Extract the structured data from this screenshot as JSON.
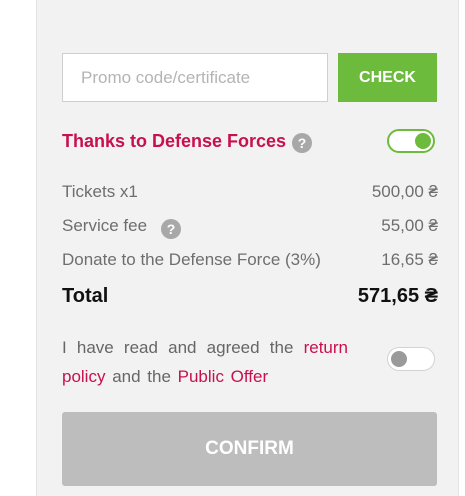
{
  "promo": {
    "placeholder": "Promo code/certificate",
    "value": "",
    "check_label": "CHECK"
  },
  "defense": {
    "label": "Thanks to Defense Forces",
    "help_icon": "question-circle-icon",
    "help_glyph": "?",
    "enabled": true
  },
  "summary": {
    "lines": [
      {
        "label": "Tickets x1",
        "value": "500,00 ₴",
        "has_help": false
      },
      {
        "label": "Service fee",
        "value": "55,00 ₴",
        "has_help": true,
        "help_glyph": "?"
      },
      {
        "label": "Donate to the Defense Force (3%)",
        "value": "16,65 ₴",
        "has_help": false
      }
    ],
    "total_label": "Total",
    "total_value": "571,65 ₴"
  },
  "agreement": {
    "text_before": "I have read and agreed the ",
    "return_policy_link": "return policy",
    "text_middle": " and the ",
    "public_offer_link": "Public Offer",
    "checked": false
  },
  "confirm": {
    "label": "CONFIRM",
    "enabled": false
  },
  "colors": {
    "accent_green": "#6cbb3c",
    "accent_crimson": "#c8104f",
    "panel_bg": "#f2f2f2",
    "disabled_button": "#bdbdbd"
  }
}
